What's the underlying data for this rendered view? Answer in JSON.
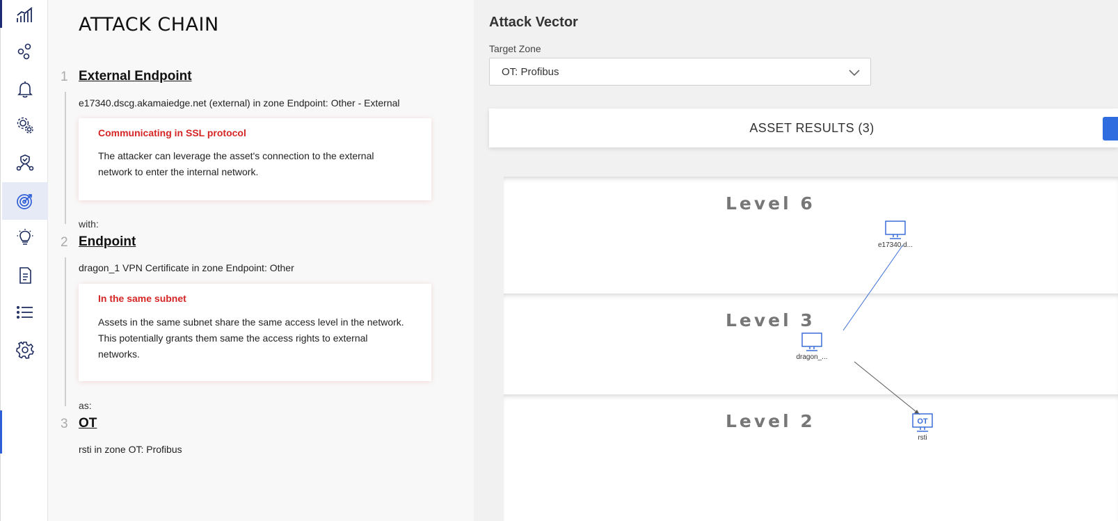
{
  "sidebar": {
    "items": [
      {
        "name": "analytics-icon",
        "active": false
      },
      {
        "name": "network-icon",
        "active": false
      },
      {
        "name": "bell-icon",
        "active": false
      },
      {
        "name": "settings-cluster-icon",
        "active": false
      },
      {
        "name": "secure-network-icon",
        "active": false
      },
      {
        "name": "target-icon",
        "active": true
      },
      {
        "name": "lightbulb-icon",
        "active": false
      },
      {
        "name": "document-icon",
        "active": false
      },
      {
        "name": "list-icon",
        "active": false
      },
      {
        "name": "gear-icon",
        "active": false
      }
    ],
    "accent": "#2f5fd6"
  },
  "chain": {
    "title": "ATTACK CHAIN",
    "steps": [
      {
        "number": "1",
        "title": "External Endpoint",
        "description": "e17340.dscg.akamaiedge.net (external) in zone Endpoint: Other - External",
        "reason_title": "Communicating in SSL protocol",
        "reason_line1": "The attacker can leverage the asset's connection to the external",
        "reason_line2": "network to enter the internal network.",
        "link_word": "with:"
      },
      {
        "number": "2",
        "title": "Endpoint",
        "description": "dragon_1 VPN Certificate in zone Endpoint: Other",
        "reason_title": "In the same subnet",
        "reason_line1": "Assets in the same subnet share the same access level in the network.",
        "reason_line2": "This potentially grants them same the access rights to external",
        "reason_line3": "networks.",
        "link_word": "as:"
      },
      {
        "number": "3",
        "title": "OT",
        "description": "rsti in zone OT: Profibus"
      }
    ]
  },
  "vector": {
    "title": "Attack Vector",
    "target_zone_label": "Target Zone",
    "target_zone_value": "OT: Profibus",
    "results_title": "ASSET RESULTS (3)",
    "levels": [
      "Level 6",
      "Level 3",
      "Level 2"
    ],
    "nodes": [
      {
        "label": "e17340.d...",
        "type": "monitor-icon"
      },
      {
        "label": "dragon_...",
        "type": "monitor-icon"
      },
      {
        "label": "rsti",
        "type": "ot-monitor-icon",
        "badge": "OT"
      }
    ],
    "colors": {
      "edge_blue": "#3a6fd8",
      "edge_gray": "#555555",
      "alert_red": "#d62525"
    }
  }
}
